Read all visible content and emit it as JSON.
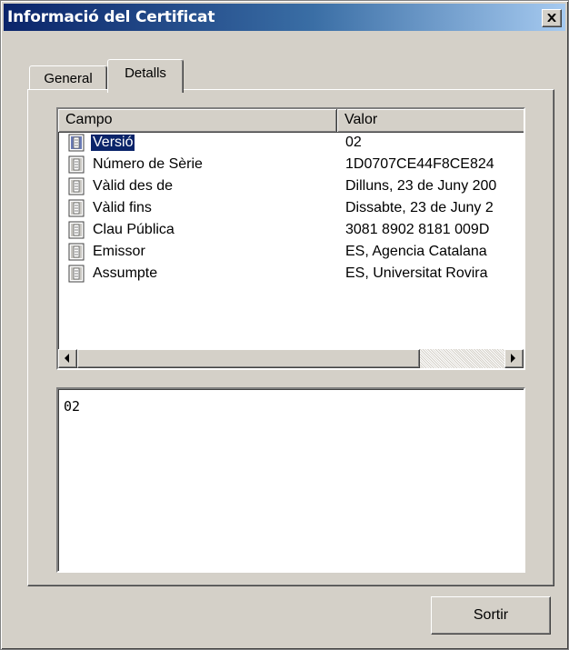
{
  "window": {
    "title": "Informació del Certificat",
    "title_gradient_start": "#0a246a",
    "title_gradient_end": "#a6caf0",
    "face_color": "#d4d0c8"
  },
  "tabs": [
    {
      "label": "General",
      "selected": false
    },
    {
      "label": "Detalls",
      "selected": true
    }
  ],
  "fields_list": {
    "columns": [
      "Campo",
      "Valor"
    ],
    "rows": [
      {
        "icon": "certificate-field-icon",
        "field": "Versió",
        "value": "02",
        "selected": true
      },
      {
        "icon": "certificate-field-icon",
        "field": "Número de Sèrie",
        "value": "1D0707CE44F8CE824",
        "selected": false
      },
      {
        "icon": "certificate-field-icon",
        "field": "Vàlid des de",
        "value": "Dilluns, 23 de Juny 200",
        "selected": false
      },
      {
        "icon": "certificate-field-icon",
        "field": "Vàlid fins",
        "value": "Dissabte, 23 de Juny 2",
        "selected": false
      },
      {
        "icon": "certificate-field-icon",
        "field": "Clau Pública",
        "value": "3081 8902 8181 009D",
        "selected": false
      },
      {
        "icon": "certificate-field-icon",
        "field": "Emissor",
        "value": "ES, Agencia Catalana",
        "selected": false
      },
      {
        "icon": "certificate-field-icon",
        "field": "Assumpte",
        "value": "ES, Universitat Rovira",
        "selected": false
      }
    ],
    "selection_color": "#0a246a"
  },
  "detail": {
    "text": "02"
  },
  "buttons": {
    "exit_label": "Sortir"
  }
}
